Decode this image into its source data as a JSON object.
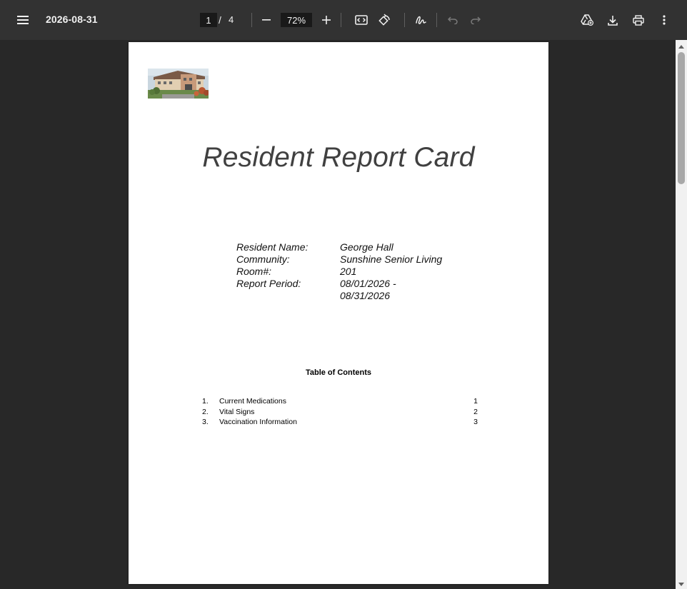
{
  "toolbar": {
    "menu_icon": "hamburger-menu-icon",
    "title": "2026-08-31",
    "current_page": "1",
    "page_separator": "/",
    "total_pages": "4",
    "zoom_value": "72%",
    "icons": {
      "zoom_out": "minus-icon",
      "zoom_in": "plus-icon",
      "fit_to_page": "fit-to-page-icon",
      "rotate": "rotate-icon",
      "annotate": "draw-icon",
      "undo": "undo-icon",
      "redo": "redo-icon",
      "add_to_drive": "drive-add-icon",
      "download": "download-icon",
      "print": "printer-icon",
      "more": "more-vert-icon"
    }
  },
  "document": {
    "title": "Resident Report Card",
    "resident_info": [
      {
        "label": "Resident Name:",
        "value": "George Hall"
      },
      {
        "label": "Community:",
        "value": "Sunshine Senior Living"
      },
      {
        "label": "Room#:",
        "value": "201"
      },
      {
        "label": "Report Period:",
        "value": "08/01/2026 -\n08/31/2026"
      }
    ],
    "toc": {
      "heading": "Table of Contents",
      "items": [
        {
          "num": "1.",
          "label": "Current Medications",
          "page": "1"
        },
        {
          "num": "2.",
          "label": "Vital Signs",
          "page": "2"
        },
        {
          "num": "3.",
          "label": "Vaccination Information",
          "page": "3"
        }
      ]
    }
  },
  "colors": {
    "toolbar_bg": "#323232",
    "viewer_bg": "#282828",
    "input_bg": "#191919",
    "toolbar_text": "#f1f1f1",
    "title_gray": "#404040"
  }
}
